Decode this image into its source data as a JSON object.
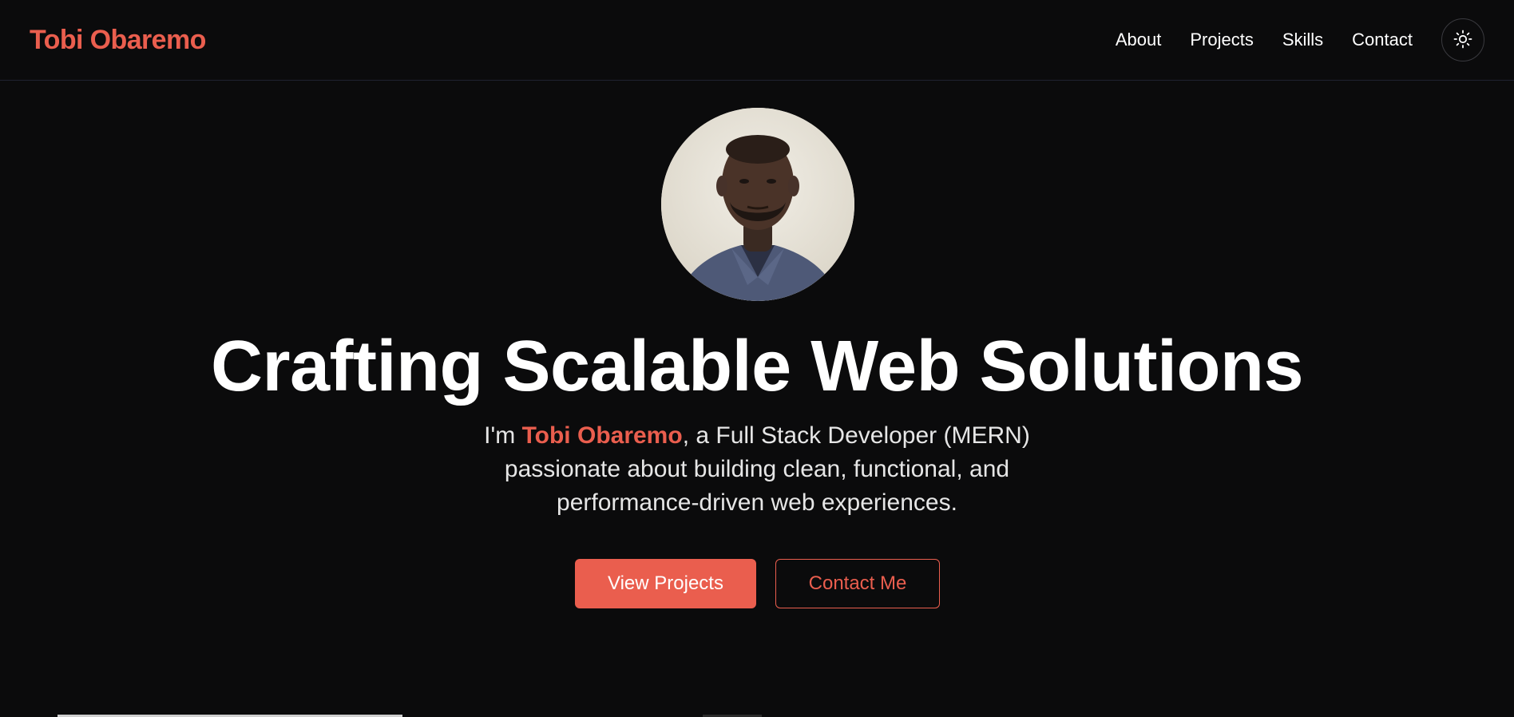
{
  "colors": {
    "accent": "#ea5e4e",
    "background": "#0b0b0c",
    "text": "#ffffff"
  },
  "header": {
    "brand": "Tobi Obaremo",
    "nav": [
      {
        "label": "About"
      },
      {
        "label": "Projects"
      },
      {
        "label": "Skills"
      },
      {
        "label": "Contact"
      }
    ],
    "theme_toggle_icon": "sun-icon"
  },
  "hero": {
    "avatar_alt": "profile-photo",
    "title": "Crafting Scalable Web Solutions",
    "subtitle_prefix": "I'm ",
    "subtitle_name": "Tobi Obaremo",
    "subtitle_rest": ", a Full Stack Developer (MERN) passionate about building clean, functional, and performance-driven web experiences.",
    "primary_button": "View Projects",
    "secondary_button": "Contact Me"
  }
}
